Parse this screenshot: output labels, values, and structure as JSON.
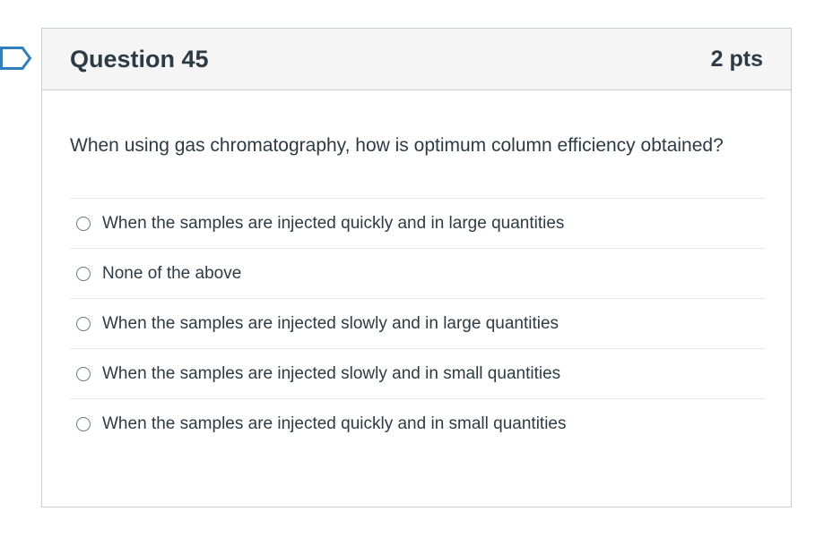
{
  "question": {
    "title": "Question 45",
    "points": "2 pts",
    "text": "When using gas chromatography, how is optimum column efficiency obtained?",
    "answers": [
      {
        "label": "When the samples are injected quickly and in large quantities"
      },
      {
        "label": "None of the above"
      },
      {
        "label": "When the samples are injected slowly and in large quantities"
      },
      {
        "label": "When the samples are injected slowly and in small quantities"
      },
      {
        "label": "When the samples are injected quickly and in small quantities"
      }
    ]
  },
  "colors": {
    "text": "#2d3b45",
    "header_bg": "#f5f5f5",
    "border": "#c7cdd1",
    "flag": "#2d7fc0"
  },
  "icons": {
    "flag": "bookmark-flag-icon",
    "radio": "radio-button-icon"
  }
}
